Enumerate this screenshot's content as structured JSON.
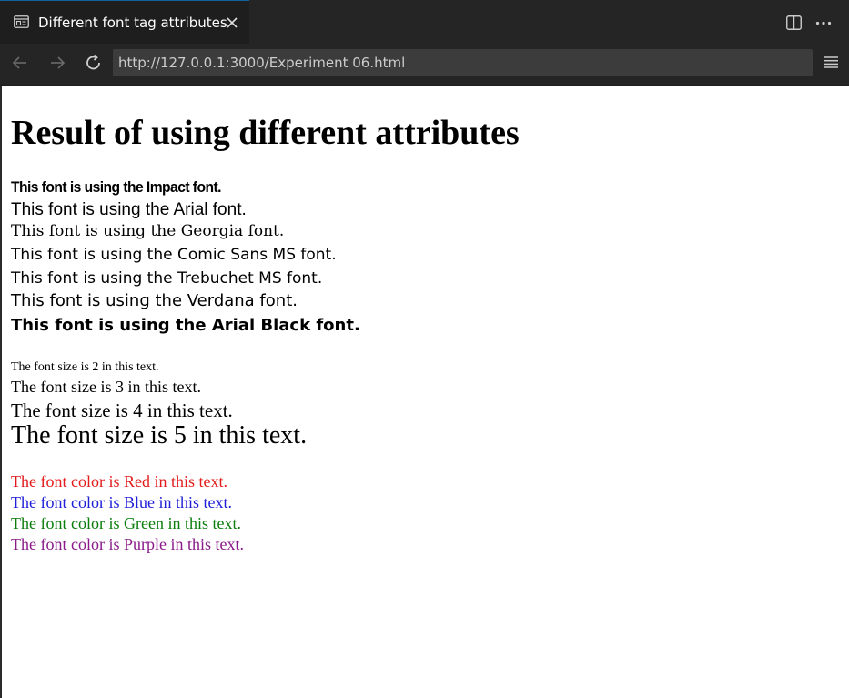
{
  "tab": {
    "title": "Different font tag attributes",
    "icon": "browser-page-icon",
    "close_icon": "close-icon"
  },
  "toolbar": {
    "split_icon": "split-editor-icon",
    "more_icon": "more-actions-icon"
  },
  "nav": {
    "back_icon": "back-arrow-icon",
    "forward_icon": "forward-arrow-icon",
    "reload_icon": "reload-icon",
    "url": "http://127.0.0.1:3000/Experiment 06.html",
    "menu_icon": "menu-icon"
  },
  "page": {
    "heading": "Result of using different attributes",
    "font_faces": [
      "This font is using the Impact font.",
      "This font is using the Arial font.",
      "This font is using the Georgia font.",
      "This font is using the Comic Sans MS font.",
      "This font is using the Trebuchet MS font.",
      "This font is using the Verdana font.",
      "This font is using the Arial Black font."
    ],
    "font_sizes": [
      "The font size is 2 in this text.",
      "The font size is 3 in this text.",
      "The font size is 4 in this text.",
      "The font size is 5 in this text."
    ],
    "font_colors": [
      "The font color is Red in this text.",
      "The font color is Blue in this text.",
      "The font color is Green in this text.",
      "The font color is Purple in this text."
    ]
  },
  "colors": {
    "red": "#e31b1b",
    "blue": "#2020d8",
    "green": "#0a7d0a",
    "purple": "#8a1a8a",
    "accent": "#0e639c"
  }
}
